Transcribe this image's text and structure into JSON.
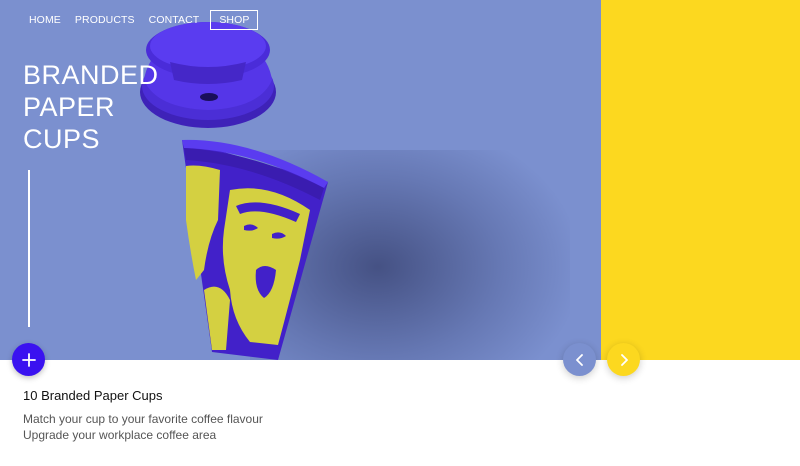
{
  "nav": {
    "items": [
      "HOME",
      "PRODUCTS",
      "CONTACT"
    ],
    "shop_label": "SHOP"
  },
  "hero": {
    "title": "BRANDED\nPAPER\nCUPS",
    "left_color": "#7b90cf",
    "right_color": "#fcd81f"
  },
  "buttons": {
    "plus_icon": "plus-icon",
    "prev_icon": "chevron-left-icon",
    "next_icon": "chevron-right-icon",
    "plus_color": "#3a12f0"
  },
  "caption": {
    "title": "10 Branded Paper Cups",
    "line1": "Match your cup to your favorite coffee flavour",
    "line2": "Upgrade your workplace coffee area"
  }
}
